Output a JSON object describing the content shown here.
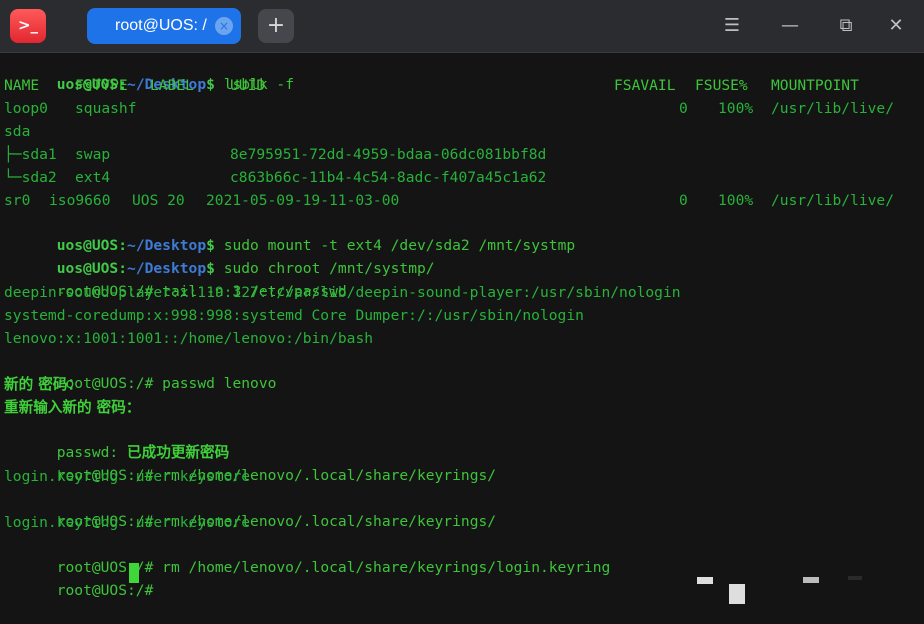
{
  "titlebar": {
    "app_icon_glyph": ">_",
    "tab_title": "root@UOS: /",
    "tab_close_glyph": "×",
    "new_tab_glyph": "+",
    "menu_glyph": "☰",
    "minimize_glyph": "—",
    "maximize_glyph": "⧉",
    "close_glyph": "✕",
    "accent_color": "#1f73e8"
  },
  "terminal": {
    "prompt_user": "uos@UOS",
    "prompt_colon": ":",
    "prompt_path": "~/Desktop",
    "prompt_dollar": "$",
    "root_prompt": "root@UOS:/#",
    "cmd_lsblk": "lsblk -f",
    "lsblk": {
      "headers": [
        "NAME",
        "FSTYPE",
        "LABEL",
        "UUID",
        "FSAVAIL",
        "FSUSE%",
        "MOUNTPOINT"
      ],
      "rows": [
        {
          "name": "loop0",
          "fstype": "squashf",
          "label": "",
          "uuid": "",
          "fsavail": "0",
          "fsuse": "100%",
          "mountpoint": "/usr/lib/live/"
        },
        {
          "name": "sda",
          "fstype": "",
          "label": "",
          "uuid": "",
          "fsavail": "",
          "fsuse": "",
          "mountpoint": ""
        },
        {
          "name": "├─sda1",
          "fstype": "swap",
          "label": "",
          "uuid": "8e795951-72dd-4959-bdaa-06dc081bbf8d",
          "fsavail": "",
          "fsuse": "",
          "mountpoint": ""
        },
        {
          "name": "└─sda2",
          "fstype": "ext4",
          "label": "",
          "uuid": "c863b66c-11b4-4c54-8adc-f407a45c1a62",
          "fsavail": "",
          "fsuse": "",
          "mountpoint": ""
        },
        {
          "name": "sr0",
          "fstype": "iso9660",
          "label": "UOS 20",
          "uuid": "2021-05-09-19-11-03-00",
          "fsavail": "0",
          "fsuse": "100%",
          "mountpoint": "/usr/lib/live/"
        }
      ]
    },
    "cmd_mount": "sudo mount -t ext4 /dev/sda2 /mnt/systmp",
    "cmd_chroot": "sudo chroot /mnt/systmp/",
    "cmd_tail": "tail -n 3 /etc/passwd",
    "passwd_lines": [
      "deepin-sound-player:x:119:127::/var/lib/deepin-sound-player:/usr/sbin/nologin",
      "systemd-coredump:x:998:998:systemd Core Dumper:/:/usr/sbin/nologin",
      "lenovo:x:1001:1001::/home/lenovo:/bin/bash"
    ],
    "cmd_passwd": "passwd lenovo",
    "new_password_prompt": "新的 密码：",
    "retype_password_prompt": "重新输入新的 密码：",
    "passwd_result_prefix": "passwd:",
    "passwd_result_msg": "已成功更新密码",
    "cmd_rm_1": "rm /home/lenovo/.local/share/keyrings/",
    "ls_output_1": "login.keyring  user.keystore",
    "cmd_rm_2": "rm /home/lenovo/.local/share/keyrings/",
    "ls_output_2": "login.keyring  user.keystore",
    "cmd_rm_3": "rm /home/lenovo/.local/share/keyrings/login.keyring",
    "text_color": "#3ec43a",
    "path_color": "#3e7bd6",
    "background_color": "#141414"
  }
}
